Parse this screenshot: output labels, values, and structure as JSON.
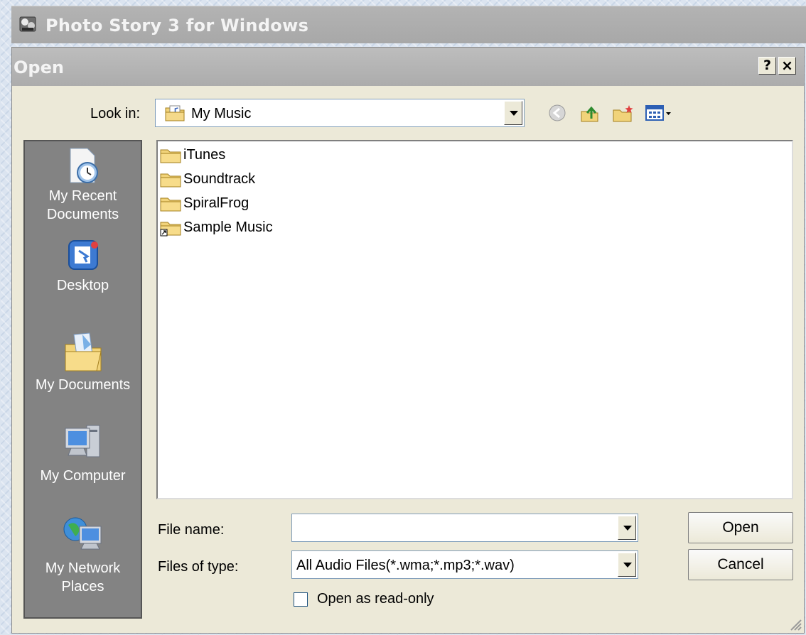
{
  "app": {
    "title": "Photo Story 3 for Windows"
  },
  "dialog": {
    "title": "Open",
    "help_glyph": "?",
    "close_glyph": "×",
    "look_in": {
      "label": "Look in:",
      "value": "My Music"
    },
    "places": [
      {
        "label": "My Recent\nDocuments",
        "icon": "recent-documents-icon"
      },
      {
        "label": "Desktop",
        "icon": "desktop-icon"
      },
      {
        "label": "My Documents",
        "icon": "my-documents-icon"
      },
      {
        "label": "My Computer",
        "icon": "my-computer-icon"
      },
      {
        "label": "My Network\nPlaces",
        "icon": "network-places-icon"
      }
    ],
    "files": [
      {
        "name": "iTunes",
        "icon": "folder-icon"
      },
      {
        "name": "Soundtrack",
        "icon": "folder-icon"
      },
      {
        "name": "SpiralFrog",
        "icon": "folder-icon"
      },
      {
        "name": "Sample Music",
        "icon": "folder-shortcut-icon"
      }
    ],
    "file_name": {
      "label": "File name:",
      "value": ""
    },
    "files_of_type": {
      "label": "Files of type:",
      "value": "All Audio Files(*.wma;*.mp3;*.wav)"
    },
    "read_only": {
      "label": "Open as read-only",
      "checked": false
    },
    "buttons": {
      "open": "Open",
      "cancel": "Cancel"
    }
  },
  "colors": {
    "places_bg": "#838383",
    "dialog_bg": "#ece9d8",
    "titlebar": "#acacac"
  }
}
